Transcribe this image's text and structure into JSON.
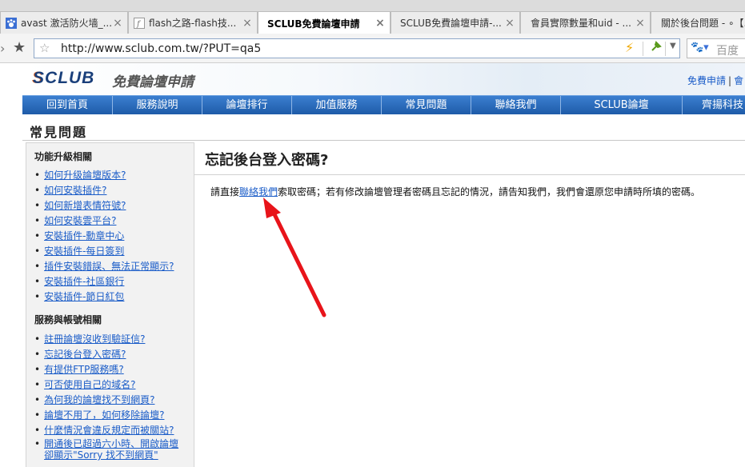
{
  "browser": {
    "tabs": [
      {
        "icon": "paw-icon",
        "title": "avast 激活防火墙_...",
        "active": false
      },
      {
        "icon": "flash-icon",
        "title": "flash之路-flash技...",
        "active": false
      },
      {
        "icon": "",
        "title": "SCLUB免費論壇申請",
        "active": true
      },
      {
        "icon": "",
        "title": "SCLUB免費論壇申請-...",
        "active": false
      },
      {
        "icon": "",
        "title": "會員實際數量和uid - ...",
        "active": false
      },
      {
        "icon": "",
        "title": "關於後台問題 - ∘【...",
        "active": false
      }
    ],
    "url": "http://www.sclub.com.tw/?PUT=qa5",
    "search_placeholder": "百度"
  },
  "site": {
    "logo": "SCLUB",
    "logo_sub": "免費論壇申請",
    "top_links": [
      "免費申請",
      "會"
    ],
    "nav": [
      "回到首頁",
      "服務說明",
      "論壇排行",
      "加值服務",
      "常見問題",
      "聯絡我們",
      "SCLUB論壇",
      "齊揚科技"
    ],
    "page_title": "常見問題"
  },
  "sidebar": {
    "section1": {
      "title": "功能升級相關",
      "items": [
        "如何升级論壇版本?",
        "如何安裝插件?",
        "如何新增表情符號?",
        "如何安裝雲平台?",
        "安裝插件-勳章中心",
        "安裝插件-每日簽到",
        "插件安裝錯誤、無法正常顯示?",
        "安裝插件-社區銀行",
        "安裝插件-節日紅包"
      ]
    },
    "section2": {
      "title": "服務與帳號相關",
      "items": [
        "註冊論壇沒收到驗証信?",
        "忘記後台登入密碼?",
        "有提供FTP服務嗎?",
        "可否使用自己的域名?",
        "為何我的論壇找不到網頁?",
        "論壇不用了，如何移除論壇?",
        "什麼情況會違反規定而被關站?"
      ],
      "last_item_line1": "開通後已超過六小時、開啟論壇",
      "last_item_line2": "卻顯示\"Sorry 找不到網頁\""
    }
  },
  "content": {
    "question": "忘記後台登入密碼?",
    "answer_before": "請直接",
    "answer_link": "聯絡我們",
    "answer_after": "索取密碼；若有修改論壇管理者密碼且忘記的情況，請告知我們，我們會還原您申請時所填的密碼。"
  },
  "colors": {
    "nav_bg": "#1e5ba8",
    "link": "#1a5cc8",
    "annotation_arrow": "#e8141a"
  }
}
